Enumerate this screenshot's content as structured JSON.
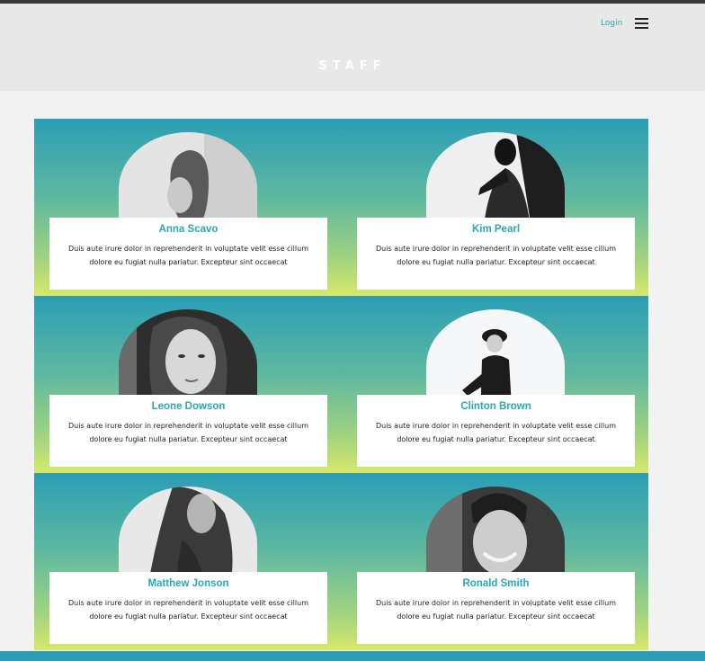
{
  "header": {
    "login_label": "Login",
    "menu_icon": "hamburger-menu-icon",
    "title": "STAFF"
  },
  "staff": [
    {
      "name": "Anna Scavo",
      "description": "Duis aute irure dolor in reprehenderit in voluptate velit esse cillum dolore eu fugiat nulla pariatur. Excepteur sint occaecat"
    },
    {
      "name": "Kim Pearl",
      "description": "Duis aute irure dolor in reprehenderit in voluptate velit esse cillum dolore eu fugiat nulla pariatur. Excepteur sint occaecat"
    },
    {
      "name": "Leone Dowson",
      "description": "Duis aute irure dolor in reprehenderit in voluptate velit esse cillum dolore eu fugiat nulla pariatur. Excepteur sint occaecat"
    },
    {
      "name": "Clinton Brown",
      "description": "Duis aute irure dolor in reprehenderit in voluptate velit esse cillum dolore eu fugiat nulla pariatur. Excepteur sint occaecat"
    },
    {
      "name": "Matthew Jonson",
      "description": "Duis aute irure dolor in reprehenderit in voluptate velit esse cillum dolore eu fugiat nulla pariatur. Excepteur sint occaecat"
    },
    {
      "name": "Ronald Smith",
      "description": "Duis aute irure dolor in reprehenderit in voluptate velit esse cillum dolore eu fugiat nulla pariatur. Excepteur sint occaecat"
    }
  ],
  "colors": {
    "accent": "#27a8b6",
    "gradient_top": "#2b9eb5",
    "gradient_bottom": "#d8e86a",
    "header_bg": "#e8e8e8"
  }
}
